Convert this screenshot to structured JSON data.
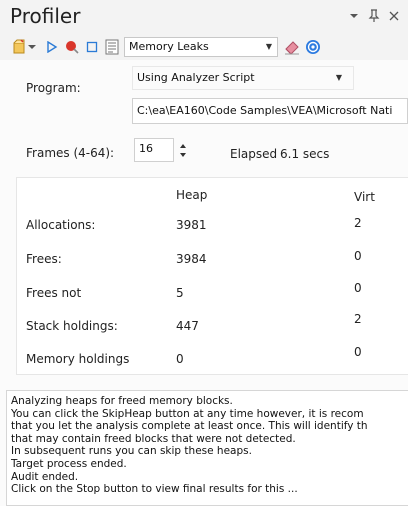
{
  "window": {
    "title": "Profiler",
    "menu_arrow_icon": "dropdown-arrow-icon",
    "pin_icon": "pin-icon",
    "close_icon": "close-icon"
  },
  "toolbar": {
    "icons": [
      "new-icon",
      "dropdown-arrow-icon",
      "play-icon",
      "record-icon",
      "stop-icon",
      "report-icon",
      "eraser-icon",
      "help-icon"
    ],
    "mode_select": "Memory Leaks"
  },
  "form": {
    "program_label": "Program:",
    "program_select": "Using Analyzer Script",
    "program_path": "C:\\ea\\EA160\\Code Samples\\VEA\\Microsoft Nati",
    "frames_label": "Frames (4-64):",
    "frames_value": "16",
    "elapsed_label": "Elapsed",
    "elapsed_value": "6.1 secs"
  },
  "stats": {
    "headers": [
      "Heap",
      "Virt"
    ],
    "rows": [
      {
        "label": "Allocations:",
        "heap": "3981",
        "virt": "2"
      },
      {
        "label": "Frees:",
        "heap": "3984",
        "virt": "0"
      },
      {
        "label": "Frees not",
        "heap": "5",
        "virt": "0"
      },
      {
        "label": "Stack holdings:",
        "heap": "447",
        "virt": "2"
      },
      {
        "label": "Memory holdings",
        "heap": "0",
        "virt": "0"
      }
    ]
  },
  "log": {
    "lines": [
      "Analyzing heaps for freed memory blocks.",
      "You can click the SkipHeap button at any time however, it is recom",
      "that you let the analysis complete at least once. This will identify th",
      "that may contain freed blocks that were not detected.",
      "In subsequent runs you can skip these heaps.",
      "Target process ended.",
      "Audit ended.",
      "    Click on the  Stop  button to view  final  results  for this  ..."
    ]
  },
  "colors": {
    "accent_blue": "#2b7bd6",
    "record_red": "#d9362b",
    "help_blue": "#2d7be0"
  }
}
